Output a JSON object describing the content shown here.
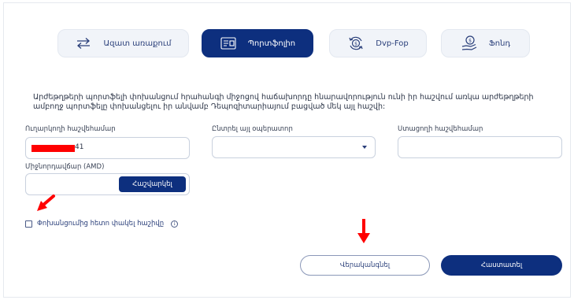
{
  "tabs": [
    {
      "label": "Ազատ առաքում",
      "icon": "transfer-arrows-icon",
      "active": false
    },
    {
      "label": "Պորտֆոլիո",
      "icon": "portfolio-document-icon",
      "active": true
    },
    {
      "label": "Dvp-Fop",
      "icon": "dollar-cycle-icon",
      "active": false
    },
    {
      "label": "Ֆոնդ",
      "icon": "hand-coin-icon",
      "active": false
    }
  ],
  "description": "Արժեթղթերի պորտֆելի փոխանցում հրահանգի միջոցով հաճախորդը հնարավորություն ունի իր հաշվում առկա արժեթղթերի ամբողջ պորտֆելը փոխանցելու իր անվամբ Դեպոզիտարիայում բացված մեկ այլ հաշվի:",
  "form": {
    "sender_label": "Ուղարկողի հաշվեհամար",
    "sender_value": "41",
    "operator_label": "Ընտրել այլ օպերատոր",
    "operator_value": "",
    "recipient_label": "Ստացողի հաշվեհամար",
    "recipient_value": "",
    "fee_label": "Միջնորդավճար (AMD)",
    "fee_value": "",
    "calculate_label": "Հաշվարկել",
    "close_account_label": "Փոխանցումից հետո փակել հաշիվը",
    "close_account_checked": false
  },
  "buttons": {
    "reset_label": "Վերականգնել",
    "confirm_label": "Հաստատել"
  },
  "colors": {
    "primary": "#0d2f7e",
    "annotation": "#ff0000",
    "tab_bg": "#f1f4f9"
  }
}
